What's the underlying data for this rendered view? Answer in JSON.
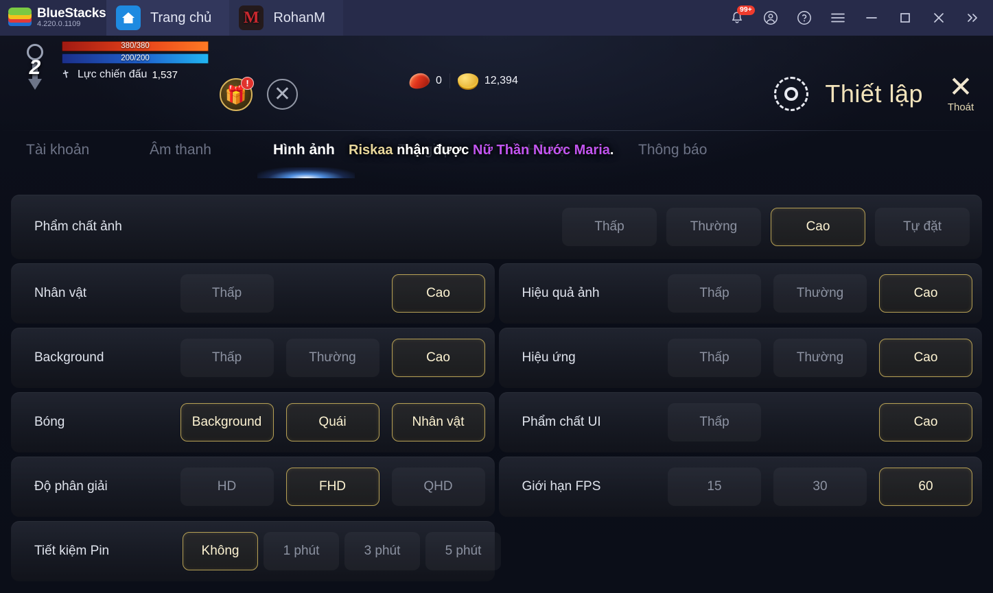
{
  "bluestacks": {
    "brand": "BlueStacks",
    "version": "4.220.0.1109",
    "tabs": [
      {
        "label": "Trang chủ",
        "icon": "home-icon"
      },
      {
        "label": "RohanM",
        "icon": "rohanm-game-icon"
      }
    ],
    "controls": {
      "notification_badge": "99+",
      "notification_icon": "bell-icon",
      "account_icon": "user-circle-icon",
      "help_icon": "question-circle-icon",
      "menu_icon": "hamburger-menu-icon",
      "minimize_icon": "minimize-icon",
      "maximize_icon": "maximize-icon",
      "close_icon": "close-icon",
      "expand_icon": "chevron-double-right-icon"
    }
  },
  "hud": {
    "level": "2",
    "hp": "380/380",
    "mp": "200/200",
    "combat_power_label": "Lực chiến đấu",
    "combat_power_value": "1,537",
    "gift_alert": "!",
    "ruby_value": "0",
    "gold_value": "12,394"
  },
  "header": {
    "title": "Thiết lập",
    "gear_icon": "gear-icon",
    "exit_label": "Thoát",
    "exit_icon": "close-x-icon"
  },
  "tabs": [
    {
      "label": "Tài khoản",
      "state": "inactive"
    },
    {
      "label": "Âm thanh",
      "state": "inactive"
    },
    {
      "label": "Hình ảnh",
      "state": "active"
    },
    {
      "label": "Trợ giúp",
      "state": "faded"
    },
    {
      "label": "Hỗ trợ",
      "state": "faded"
    },
    {
      "label": "Thông báo",
      "state": "inactive"
    }
  ],
  "ticker": {
    "player": "Riskaa",
    "middle": "nhận được",
    "item": "Nữ Thần Nước Maria",
    "period": "."
  },
  "settings": {
    "quality": {
      "label": "Phẩm chất ảnh",
      "options": [
        {
          "label": "Thấp",
          "selected": false
        },
        {
          "label": "Thường",
          "selected": false
        },
        {
          "label": "Cao",
          "selected": true
        },
        {
          "label": "Tự đặt",
          "selected": false
        }
      ]
    },
    "left_rows": [
      {
        "label": "Nhân vật",
        "options": [
          {
            "label": "Thấp",
            "selected": false,
            "visible": true
          },
          {
            "label": "",
            "selected": false,
            "visible": false
          },
          {
            "label": "Cao",
            "selected": true,
            "visible": true
          }
        ]
      },
      {
        "label": "Background",
        "options": [
          {
            "label": "Thấp",
            "selected": false,
            "visible": true
          },
          {
            "label": "Thường",
            "selected": false,
            "visible": true
          },
          {
            "label": "Cao",
            "selected": true,
            "visible": true
          }
        ]
      },
      {
        "label": "Bóng",
        "options": [
          {
            "label": "Background",
            "selected": true,
            "visible": true
          },
          {
            "label": "Quái",
            "selected": true,
            "visible": true
          },
          {
            "label": "Nhân vật",
            "selected": true,
            "visible": true
          }
        ]
      },
      {
        "label": "Độ phân giải",
        "options": [
          {
            "label": "HD",
            "selected": false,
            "visible": true
          },
          {
            "label": "FHD",
            "selected": true,
            "visible": true
          },
          {
            "label": "QHD",
            "selected": false,
            "visible": true
          }
        ]
      }
    ],
    "right_rows": [
      {
        "label": "Hiệu quả ảnh",
        "options": [
          {
            "label": "Thấp",
            "selected": false,
            "visible": true
          },
          {
            "label": "Thường",
            "selected": false,
            "visible": true
          },
          {
            "label": "Cao",
            "selected": true,
            "visible": true
          }
        ]
      },
      {
        "label": "Hiệu ứng",
        "options": [
          {
            "label": "Thấp",
            "selected": false,
            "visible": true
          },
          {
            "label": "Thường",
            "selected": false,
            "visible": true
          },
          {
            "label": "Cao",
            "selected": true,
            "visible": true
          }
        ]
      },
      {
        "label": "Phẩm chất UI",
        "options": [
          {
            "label": "Thấp",
            "selected": false,
            "visible": true
          },
          {
            "label": "",
            "selected": false,
            "visible": false
          },
          {
            "label": "Cao",
            "selected": true,
            "visible": true
          }
        ]
      },
      {
        "label": "Giới hạn FPS",
        "options": [
          {
            "label": "15",
            "selected": false,
            "visible": true
          },
          {
            "label": "30",
            "selected": false,
            "visible": true
          },
          {
            "label": "60",
            "selected": true,
            "visible": true
          }
        ]
      }
    ],
    "battery": {
      "label": "Tiết kiệm Pin",
      "options": [
        {
          "label": "Không",
          "selected": true
        },
        {
          "label": "1 phút",
          "selected": false
        },
        {
          "label": "3 phút",
          "selected": false
        },
        {
          "label": "5 phút",
          "selected": false
        }
      ]
    }
  },
  "colors": {
    "accent_gold": "#b6a055",
    "selected_text": "#fdf3d2",
    "title_gold": "#f2e3bb",
    "item_purple": "#c255f0",
    "player_gold": "#e8d79b",
    "badge_red": "#ef3b2d",
    "bluestacks_bar": "#272b4a"
  }
}
